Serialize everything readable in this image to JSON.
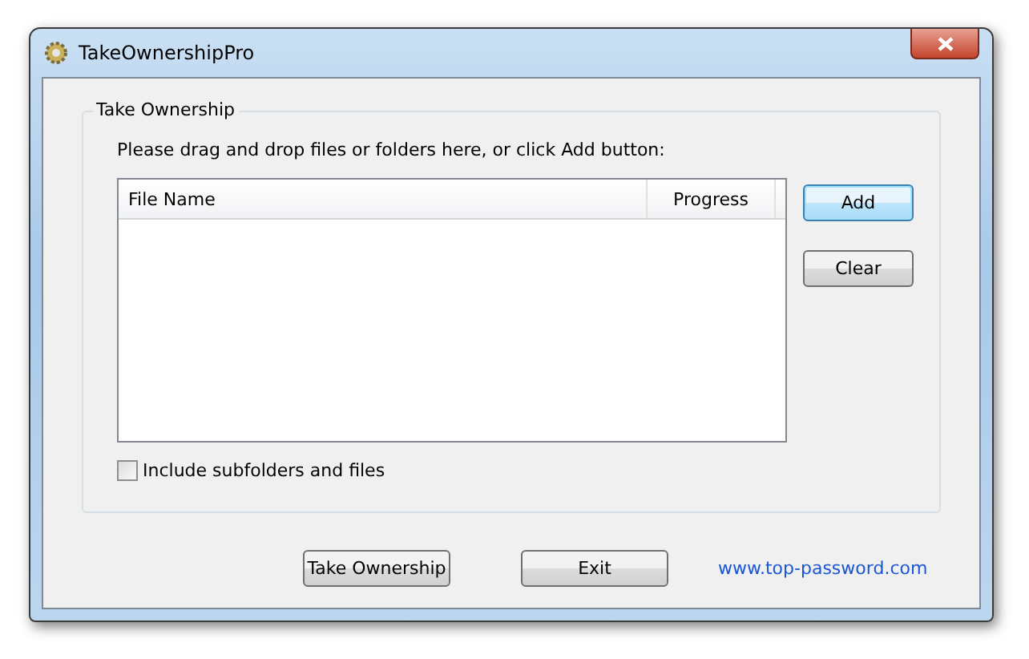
{
  "window": {
    "title": "TakeOwnershipPro"
  },
  "group": {
    "title": "Take Ownership",
    "instruction": "Please drag and drop files or folders here, or click Add button:"
  },
  "file_list": {
    "columns": [
      "File Name",
      "Progress"
    ]
  },
  "side_buttons": [
    {
      "label": "Add",
      "focused": true
    },
    {
      "label": "Clear",
      "focused": false
    }
  ],
  "include_subfolders": {
    "label": "Include subfolders and files",
    "checked": false
  },
  "bottom_buttons": [
    {
      "label": "Take Ownership",
      "focused": false
    },
    {
      "label": "Exit",
      "focused": false
    }
  ],
  "link": "www.top-password.com"
}
